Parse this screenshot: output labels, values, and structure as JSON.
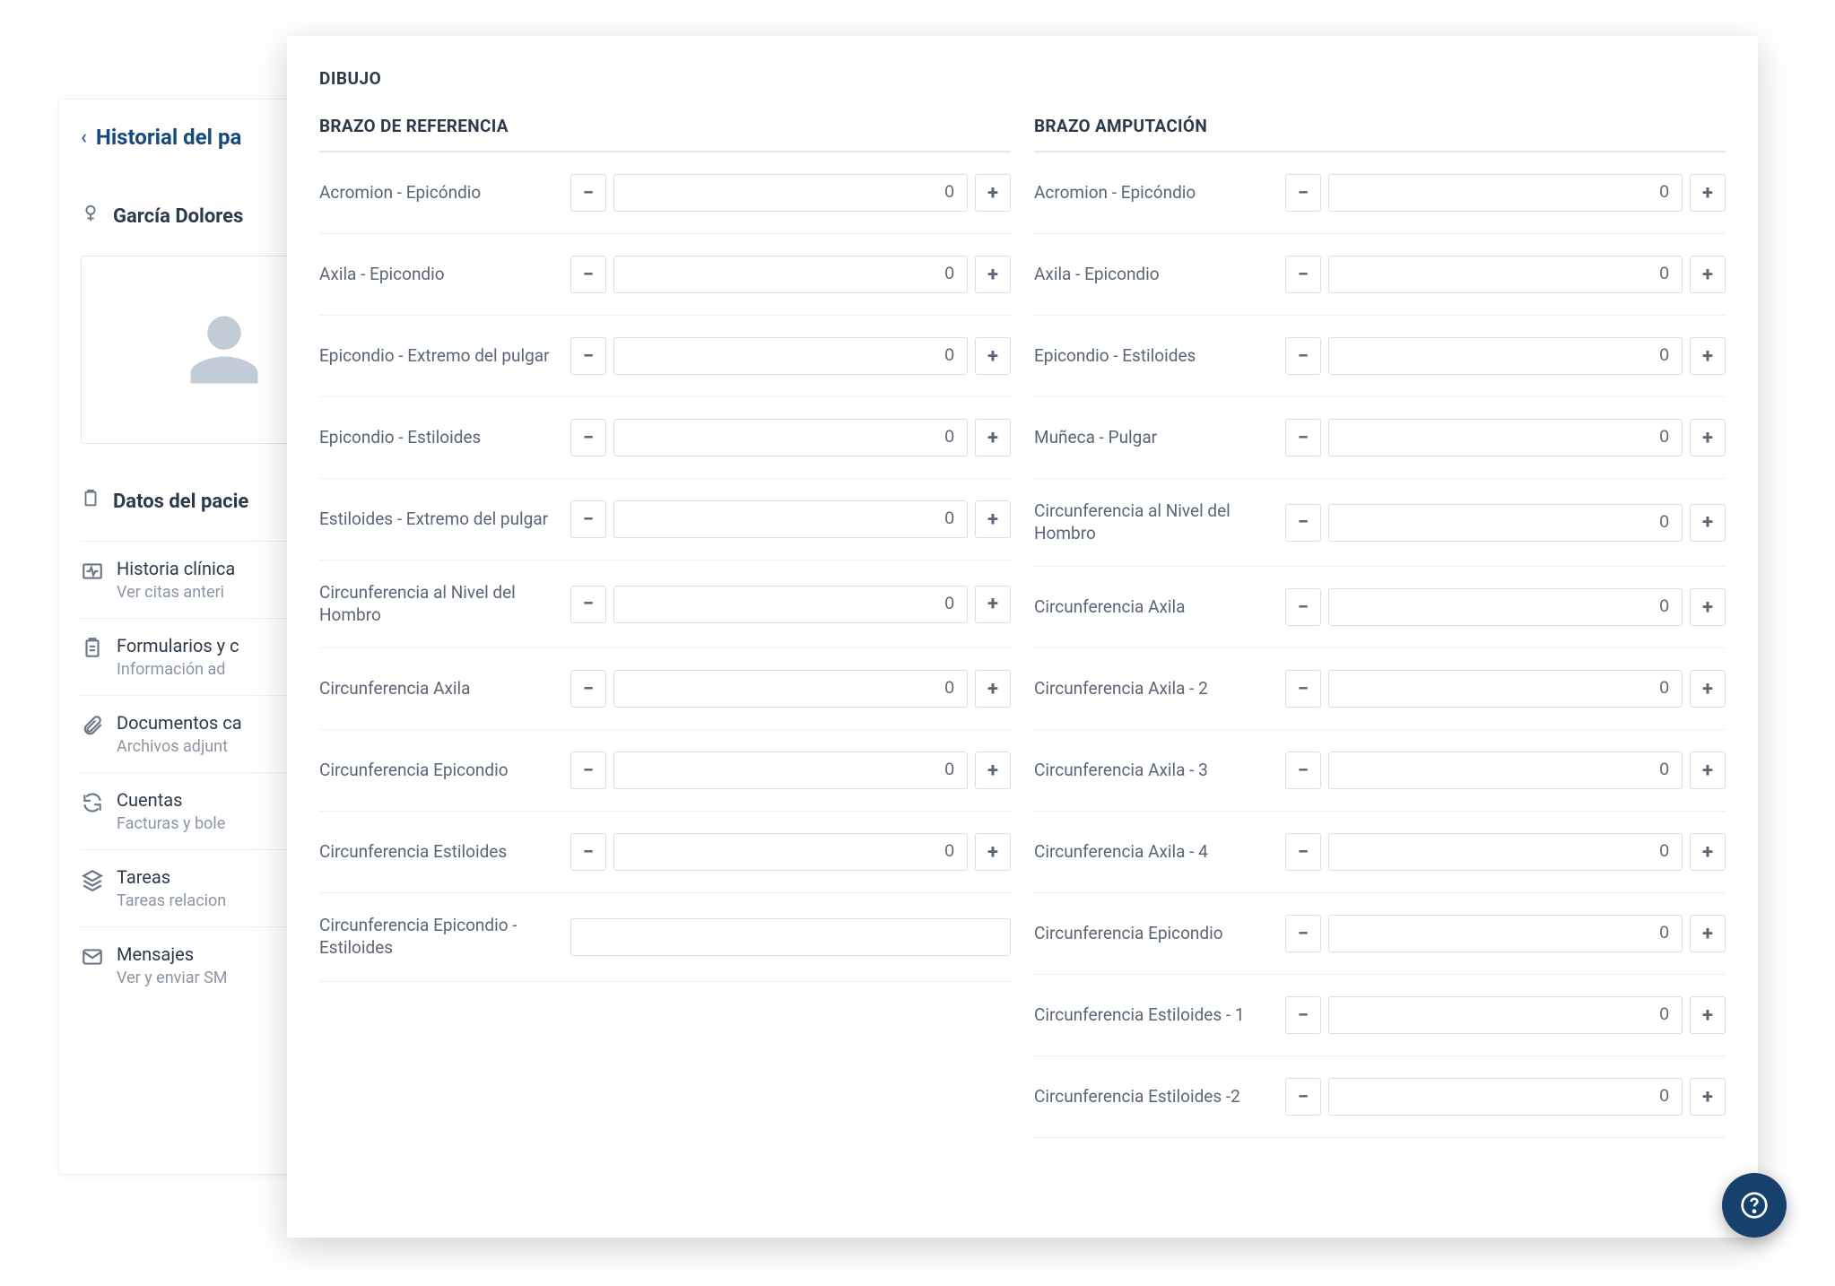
{
  "bg": {
    "back_label": "Historial del pa",
    "patient_name": "García Dolores",
    "section_label": "Datos del pacie",
    "menu": [
      {
        "title": "Historia clínica",
        "subtitle": "Ver citas anteri",
        "icon": "heartbeat"
      },
      {
        "title": "Formularios y c",
        "subtitle": "Información ad",
        "icon": "clipboard"
      },
      {
        "title": "Documentos ca",
        "subtitle": "Archivos adjunt",
        "icon": "paperclip"
      },
      {
        "title": "Cuentas",
        "subtitle": "Facturas y bole",
        "icon": "refresh"
      },
      {
        "title": "Tareas",
        "subtitle": "Tareas relacion",
        "icon": "layers"
      },
      {
        "title": "Mensajes",
        "subtitle": "Ver y enviar SM",
        "icon": "mail"
      }
    ]
  },
  "fg": {
    "title": "DIBUJO",
    "left": {
      "title": "BRAZO DE REFERENCIA",
      "rows": [
        {
          "label": "Acromion - Epicóndio",
          "value": "0",
          "type": "stepper"
        },
        {
          "label": "Axila - Epicondio",
          "value": "0",
          "type": "stepper"
        },
        {
          "label": "Epicondio - Extremo del pulgar",
          "value": "0",
          "type": "stepper"
        },
        {
          "label": "Epicondio - Estiloides",
          "value": "0",
          "type": "stepper"
        },
        {
          "label": "Estiloides - Extremo del pulgar",
          "value": "0",
          "type": "stepper"
        },
        {
          "label": "Circunferencia al Nivel del Hombro",
          "value": "0",
          "type": "stepper"
        },
        {
          "label": "Circunferencia Axila",
          "value": "0",
          "type": "stepper"
        },
        {
          "label": "Circunferencia Epicondio",
          "value": "0",
          "type": "stepper"
        },
        {
          "label": "Circunferencia Estiloides",
          "value": "0",
          "type": "stepper"
        },
        {
          "label": "Circunferencia Epicondio - Estiloides",
          "value": "",
          "type": "text"
        }
      ]
    },
    "right": {
      "title": "BRAZO AMPUTACIÓN",
      "rows": [
        {
          "label": "Acromion - Epicóndio",
          "value": "0",
          "type": "stepper"
        },
        {
          "label": "Axila - Epicondio",
          "value": "0",
          "type": "stepper"
        },
        {
          "label": "Epicondio - Estiloides",
          "value": "0",
          "type": "stepper"
        },
        {
          "label": "Muñeca - Pulgar",
          "value": "0",
          "type": "stepper"
        },
        {
          "label": "Circunferencia al Nivel del Hombro",
          "value": "0",
          "type": "stepper"
        },
        {
          "label": "Circunferencia Axila",
          "value": "0",
          "type": "stepper"
        },
        {
          "label": "Circunferencia Axila - 2",
          "value": "0",
          "type": "stepper"
        },
        {
          "label": "Circunferencia Axila - 3",
          "value": "0",
          "type": "stepper"
        },
        {
          "label": "Circunferencia Axila - 4",
          "value": "0",
          "type": "stepper"
        },
        {
          "label": "Circunferencia Epicondio",
          "value": "0",
          "type": "stepper"
        },
        {
          "label": "Circunferencia Estiloides - 1",
          "value": "0",
          "type": "stepper"
        },
        {
          "label": "Circunferencia Estiloides -2",
          "value": "0",
          "type": "stepper"
        }
      ]
    }
  },
  "help_label": "?"
}
